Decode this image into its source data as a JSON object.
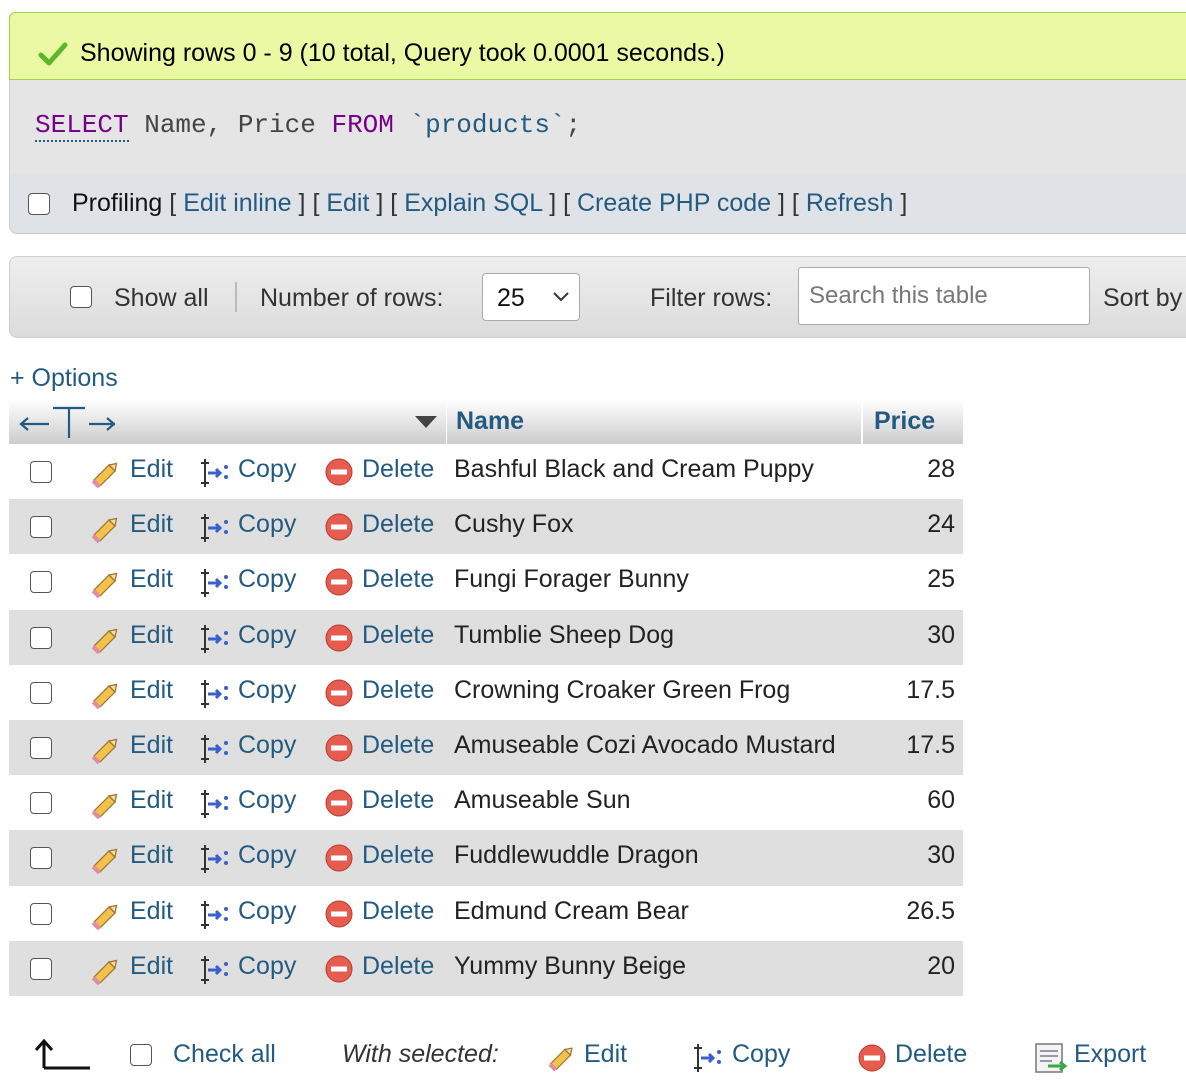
{
  "status": {
    "message": "Showing rows 0 - 9 (10 total, Query took 0.0001 seconds.)",
    "color": "#ebf8a4"
  },
  "sql": {
    "kw_select": "SELECT",
    "fields": " Name, Price ",
    "kw_from": "FROM",
    "table": " `products`",
    "end": ";"
  },
  "profiling": {
    "label": "Profiling",
    "links": [
      "Edit inline",
      "Edit",
      "Explain SQL",
      "Create PHP code",
      "Refresh"
    ]
  },
  "nav": {
    "show_all": "Show all",
    "num_rows_label": "Number of rows:",
    "num_rows_value": "25",
    "filter_label": "Filter rows:",
    "filter_placeholder": "Search this table",
    "sort_label": "Sort by"
  },
  "options_label": "+ Options",
  "table": {
    "columns": [
      "Name",
      "Price"
    ],
    "action_labels": {
      "edit": "Edit",
      "copy": "Copy",
      "delete": "Delete"
    },
    "rows": [
      {
        "name": "Bashful Black and Cream Puppy",
        "price": "28"
      },
      {
        "name": "Cushy Fox",
        "price": "24"
      },
      {
        "name": "Fungi Forager Bunny",
        "price": "25"
      },
      {
        "name": "Tumblie Sheep Dog",
        "price": "30"
      },
      {
        "name": "Crowning Croaker Green Frog",
        "price": "17.5"
      },
      {
        "name": "Amuseable Cozi Avocado Mustard",
        "price": "17.5"
      },
      {
        "name": "Amuseable Sun",
        "price": "60"
      },
      {
        "name": "Fuddlewuddle Dragon",
        "price": "30"
      },
      {
        "name": "Edmund Cream Bear",
        "price": "26.5"
      },
      {
        "name": "Yummy Bunny Beige",
        "price": "20"
      }
    ]
  },
  "footer": {
    "check_all": "Check all",
    "with_selected": "With selected:",
    "edit": "Edit",
    "copy": "Copy",
    "delete": "Delete",
    "export": "Export"
  },
  "icons": [
    "check-icon",
    "pencil-icon",
    "copy-icon",
    "delete-icon",
    "export-icon",
    "arrow-up-icon",
    "column-resize-icon",
    "sort-arrow-icon",
    "chevron-down-icon"
  ]
}
